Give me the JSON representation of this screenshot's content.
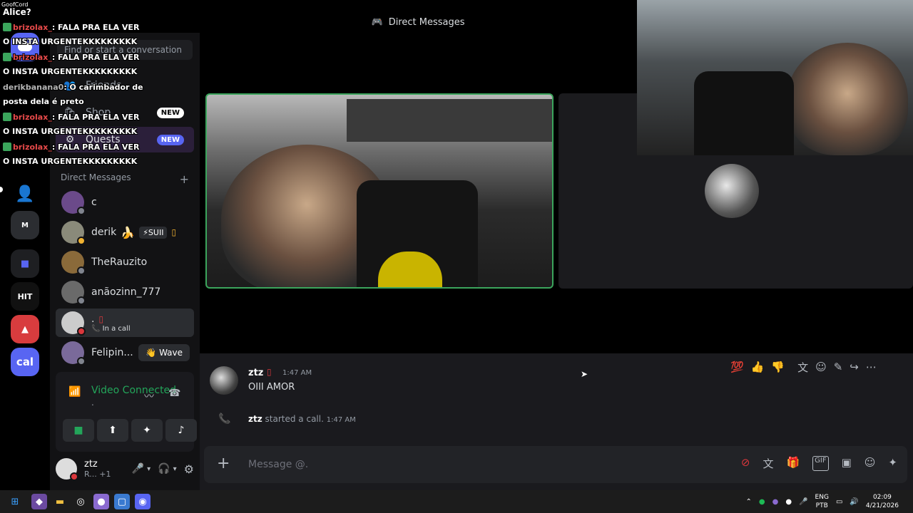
{
  "overlay": {
    "app_name": "GoofCord",
    "first_line": "Alice?",
    "lines": [
      {
        "user": "brizolax_",
        "text": ": FALA PRA ELA VER",
        "cont": "O INSTA URGENTEKKKKKKKKK"
      },
      {
        "user": "brizolax_",
        "text": ": FALA PRA ELA VER",
        "cont": "O INSTA URGENTEKKKKKKKKK"
      },
      {
        "user": "derikbanana0",
        "text": ": O carimbador de",
        "cont": "posta dela é preto"
      },
      {
        "user": "brizolax_",
        "text": ": FALA PRA ELA VER",
        "cont": "O INSTA URGENTEKKKKKKKKK"
      },
      {
        "user": "brizolax_",
        "text": ": FALA PRA ELA VER",
        "cont": "O INSTA URGENTEKKKKKKKKK"
      }
    ]
  },
  "header": {
    "title": "Direct Messages"
  },
  "sidebar": {
    "search_placeholder": "Find or start a conversation",
    "nav": [
      {
        "label": "Friends",
        "icon": "friends-icon"
      },
      {
        "label": "Shop",
        "icon": "shop-icon",
        "badge": "NEW"
      },
      {
        "label": "Quests",
        "icon": "quests-icon",
        "badge": "NEW"
      }
    ],
    "dm_header": "Direct Messages",
    "dm_add": "+",
    "dms": [
      {
        "name": "c",
        "sub": "",
        "tag": ""
      },
      {
        "name": "derik",
        "sub": "",
        "tag": "⚡SUII"
      },
      {
        "name": "TheRauzito",
        "sub": "",
        "tag": ""
      },
      {
        "name": "anãozinn_777",
        "sub": "",
        "tag": ""
      },
      {
        "name": ".",
        "sub": "In a call",
        "tag": ""
      },
      {
        "name": "Felipin...",
        "sub": "",
        "tag": "",
        "action": "Wave"
      }
    ]
  },
  "voice": {
    "status": "Video Connected",
    "channel": "."
  },
  "user": {
    "name": "ztz",
    "status": "R...",
    "extra": "+1"
  },
  "chat": {
    "message": {
      "author": "ztz",
      "time": "1:47 AM",
      "text": "OIII AMOR"
    },
    "system": {
      "author": "ztz",
      "text": "started a call.",
      "time": "1:47 AM"
    },
    "composer_placeholder": "Message @."
  },
  "taskbar": {
    "lang_top": "ENG",
    "lang_bottom": "PTB",
    "time": "02:09",
    "date": "4/21/2026"
  },
  "colors": {
    "accent": "#5865f2",
    "green": "#23a55a",
    "bg": "#000000"
  }
}
